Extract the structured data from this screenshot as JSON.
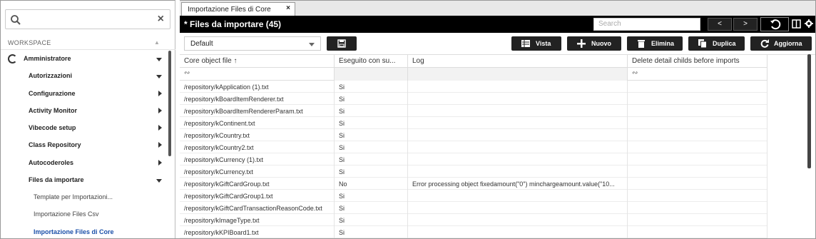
{
  "sidebar": {
    "search_placeholder": "",
    "workspace_label": "WORKSPACE",
    "user_label": "Amministratore",
    "items": [
      {
        "label": "Autorizzazioni"
      },
      {
        "label": "Configurazione"
      },
      {
        "label": "Activity Monitor"
      },
      {
        "label": "Vibecode setup"
      },
      {
        "label": "Class Repository"
      },
      {
        "label": "Autocoderoles"
      },
      {
        "label": "Files da importare"
      }
    ],
    "subitems": [
      {
        "label": "Template per Importazioni..."
      },
      {
        "label": "Importazione Files Csv"
      },
      {
        "label": "Importazione Files di Core"
      }
    ]
  },
  "tab": {
    "label": "Importazione Files di Core",
    "close": "×"
  },
  "topbar": {
    "title": "* Files da importare (45)",
    "search_placeholder": "Search",
    "prev": "<",
    "next": ">"
  },
  "toolbar": {
    "view_select": "Default",
    "vista": "Vista",
    "nuovo": "Nuovo",
    "elimina": "Elimina",
    "duplica": "Duplica",
    "aggiorna": "Aggiorna"
  },
  "grid": {
    "columns": [
      "Core object file ↑",
      "Eseguito con su...",
      "Log",
      "Delete detail childs before imports"
    ],
    "filter_symbol": "∾",
    "rows": [
      {
        "file": "/repository/kApplication (1).txt",
        "done": "Si",
        "log": ""
      },
      {
        "file": "/repository/kBoardItemRenderer.txt",
        "done": "Si",
        "log": ""
      },
      {
        "file": "/repository/kBoardItemRendererParam.txt",
        "done": "Si",
        "log": ""
      },
      {
        "file": "/repository/kContinent.txt",
        "done": "Si",
        "log": ""
      },
      {
        "file": "/repository/kCountry.txt",
        "done": "Si",
        "log": ""
      },
      {
        "file": "/repository/kCountry2.txt",
        "done": "Si",
        "log": ""
      },
      {
        "file": "/repository/kCurrency (1).txt",
        "done": "Si",
        "log": ""
      },
      {
        "file": "/repository/kCurrency.txt",
        "done": "Si",
        "log": ""
      },
      {
        "file": "/repository/kGiftCardGroup.txt",
        "done": "No",
        "log": "Error processing object fixedamount(\"0\") minchargeamount.value(\"10..."
      },
      {
        "file": "/repository/kGiftCardGroup1.txt",
        "done": "Si",
        "log": ""
      },
      {
        "file": "/repository/kGiftCardTransactionReasonCode.txt",
        "done": "Si",
        "log": ""
      },
      {
        "file": "/repository/kImageType.txt",
        "done": "Si",
        "log": ""
      },
      {
        "file": "/repository/kKPIBoard1.txt",
        "done": "Si",
        "log": ""
      }
    ]
  }
}
